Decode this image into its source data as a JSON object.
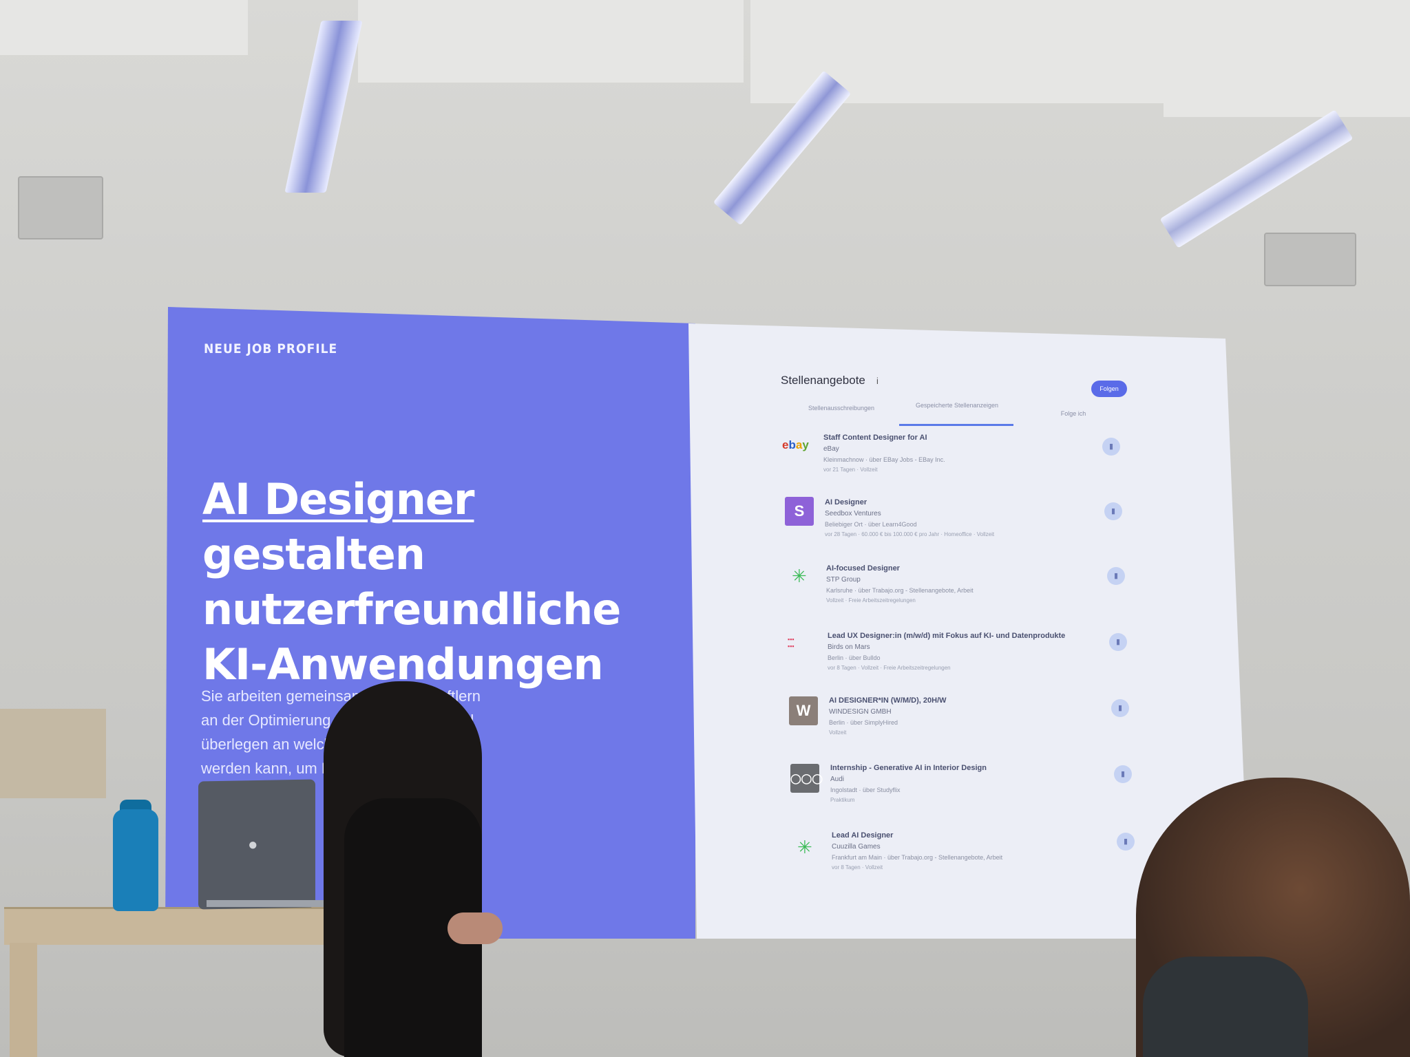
{
  "slide": {
    "eyebrow": "NEUE JOB PROFILE",
    "headline_underlined": "AI Designer",
    "headline_rest_1": " gestalten",
    "headline_line2": "nutzerfreundliche",
    "headline_line3": "KI-Anwendungen",
    "body_lines": [
      "Sie arbeiten gemeinsam      wissenschaftlern",
      "an der Optimierung und         KI Modellen und",
      "überlegen an welchen          nvoll eingesetzt",
      "werden kann, um Proz          nfachen."
    ],
    "accent_color": "#6f78e8"
  },
  "jobs_panel": {
    "title": "Stellenangebote",
    "count": "i",
    "follow_label": "Folgen",
    "tabs": [
      "Stellenausschreibungen",
      "Gespeicherte Stellenanzeigen",
      "Folge ich"
    ],
    "jobs": [
      {
        "title": "Staff Content Designer for AI",
        "company": "eBay",
        "location": "Kleinmachnow · über EBay Jobs - EBay Inc.",
        "meta": "vor 21 Tagen · Vollzeit",
        "logo": "ebay"
      },
      {
        "title": "AI Designer",
        "company": "Seedbox Ventures",
        "location": "Beliebiger Ort · über Learn4Good",
        "meta": "vor 28 Tagen · 60.000 € bis 100.000 € pro Jahr · Homeoffice · Vollzeit",
        "logo": "S"
      },
      {
        "title": "AI-focused Designer",
        "company": "STP Group",
        "location": "Karlsruhe · über Trabajo.org - Stellenangebote, Arbeit",
        "meta": "Vollzeit · Freie Arbeitszeitregelungen",
        "logo": "star"
      },
      {
        "title": "Lead UX Designer:in (m/w/d) mit Fokus auf KI- und Datenprodukte",
        "company": "Birds on Mars",
        "location": "Berlin · über Bulldo",
        "meta": "vor 8 Tagen · Vollzeit · Freie Arbeitszeitregelungen",
        "logo": "birds"
      },
      {
        "title": "AI DESIGNER*IN (W/M/D), 20H/W",
        "company": "WINDESIGN GMBH",
        "location": "Berlin · über SimplyHired",
        "meta": "Vollzeit",
        "logo": "W"
      },
      {
        "title": "Internship - Generative AI in Interior Design",
        "company": "Audi",
        "location": "Ingolstadt · über Studyflix",
        "meta": "Praktikum",
        "logo": "audi"
      },
      {
        "title": "Lead AI Designer",
        "company": "Cuuzilla Games",
        "location": "Frankfurt am Main · über Trabajo.org - Stellenangebote, Arbeit",
        "meta": "vor 8 Tagen · Vollzeit",
        "logo": "star"
      }
    ]
  }
}
